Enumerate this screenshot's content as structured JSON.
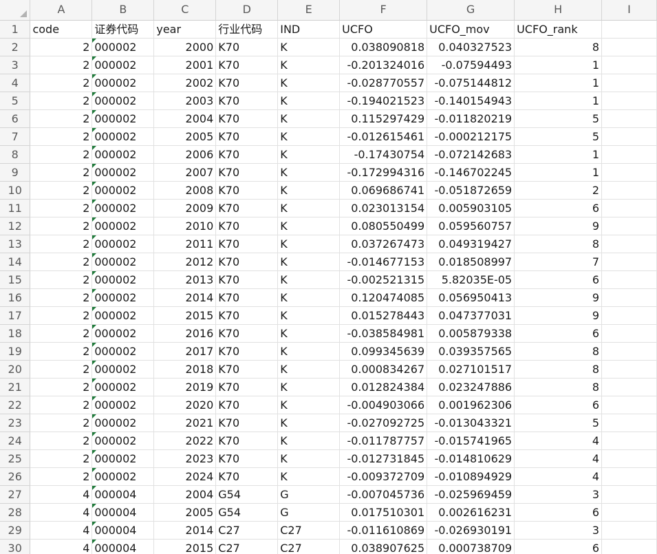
{
  "columns": [
    "A",
    "B",
    "C",
    "D",
    "E",
    "F",
    "G",
    "H",
    "I"
  ],
  "header": [
    "code",
    "证券代码",
    "year",
    "行业代码",
    "IND",
    "UCFO",
    "UCFO_mov",
    "UCFO_rank"
  ],
  "rows": [
    {
      "n": "2",
      "code": "2",
      "sec": "000002",
      "year": "2000",
      "ind_code": "K70",
      "ind": "K",
      "ucfo": "0.038090818",
      "mov": "0.040327523",
      "rank": "8"
    },
    {
      "n": "3",
      "code": "2",
      "sec": "000002",
      "year": "2001",
      "ind_code": "K70",
      "ind": "K",
      "ucfo": "-0.201324016",
      "mov": "-0.07594493",
      "rank": "1"
    },
    {
      "n": "4",
      "code": "2",
      "sec": "000002",
      "year": "2002",
      "ind_code": "K70",
      "ind": "K",
      "ucfo": "-0.028770557",
      "mov": "-0.075144812",
      "rank": "1"
    },
    {
      "n": "5",
      "code": "2",
      "sec": "000002",
      "year": "2003",
      "ind_code": "K70",
      "ind": "K",
      "ucfo": "-0.194021523",
      "mov": "-0.140154943",
      "rank": "1"
    },
    {
      "n": "6",
      "code": "2",
      "sec": "000002",
      "year": "2004",
      "ind_code": "K70",
      "ind": "K",
      "ucfo": "0.115297429",
      "mov": "-0.011820219",
      "rank": "5"
    },
    {
      "n": "7",
      "code": "2",
      "sec": "000002",
      "year": "2005",
      "ind_code": "K70",
      "ind": "K",
      "ucfo": "-0.012615461",
      "mov": "-0.000212175",
      "rank": "5"
    },
    {
      "n": "8",
      "code": "2",
      "sec": "000002",
      "year": "2006",
      "ind_code": "K70",
      "ind": "K",
      "ucfo": "-0.17430754",
      "mov": "-0.072142683",
      "rank": "1"
    },
    {
      "n": "9",
      "code": "2",
      "sec": "000002",
      "year": "2007",
      "ind_code": "K70",
      "ind": "K",
      "ucfo": "-0.172994316",
      "mov": "-0.146702245",
      "rank": "1"
    },
    {
      "n": "10",
      "code": "2",
      "sec": "000002",
      "year": "2008",
      "ind_code": "K70",
      "ind": "K",
      "ucfo": "0.069686741",
      "mov": "-0.051872659",
      "rank": "2"
    },
    {
      "n": "11",
      "code": "2",
      "sec": "000002",
      "year": "2009",
      "ind_code": "K70",
      "ind": "K",
      "ucfo": "0.023013154",
      "mov": "0.005903105",
      "rank": "6"
    },
    {
      "n": "12",
      "code": "2",
      "sec": "000002",
      "year": "2010",
      "ind_code": "K70",
      "ind": "K",
      "ucfo": "0.080550499",
      "mov": "0.059560757",
      "rank": "9"
    },
    {
      "n": "13",
      "code": "2",
      "sec": "000002",
      "year": "2011",
      "ind_code": "K70",
      "ind": "K",
      "ucfo": "0.037267473",
      "mov": "0.049319427",
      "rank": "8"
    },
    {
      "n": "14",
      "code": "2",
      "sec": "000002",
      "year": "2012",
      "ind_code": "K70",
      "ind": "K",
      "ucfo": "-0.014677153",
      "mov": "0.018508997",
      "rank": "7"
    },
    {
      "n": "15",
      "code": "2",
      "sec": "000002",
      "year": "2013",
      "ind_code": "K70",
      "ind": "K",
      "ucfo": "-0.002521315",
      "mov": "5.82035E-05",
      "rank": "6"
    },
    {
      "n": "16",
      "code": "2",
      "sec": "000002",
      "year": "2014",
      "ind_code": "K70",
      "ind": "K",
      "ucfo": "0.120474085",
      "mov": "0.056950413",
      "rank": "9"
    },
    {
      "n": "17",
      "code": "2",
      "sec": "000002",
      "year": "2015",
      "ind_code": "K70",
      "ind": "K",
      "ucfo": "0.015278443",
      "mov": "0.047377031",
      "rank": "9"
    },
    {
      "n": "18",
      "code": "2",
      "sec": "000002",
      "year": "2016",
      "ind_code": "K70",
      "ind": "K",
      "ucfo": "-0.038584981",
      "mov": "0.005879338",
      "rank": "6"
    },
    {
      "n": "19",
      "code": "2",
      "sec": "000002",
      "year": "2017",
      "ind_code": "K70",
      "ind": "K",
      "ucfo": "0.099345639",
      "mov": "0.039357565",
      "rank": "8"
    },
    {
      "n": "20",
      "code": "2",
      "sec": "000002",
      "year": "2018",
      "ind_code": "K70",
      "ind": "K",
      "ucfo": "0.000834267",
      "mov": "0.027101517",
      "rank": "8"
    },
    {
      "n": "21",
      "code": "2",
      "sec": "000002",
      "year": "2019",
      "ind_code": "K70",
      "ind": "K",
      "ucfo": "0.012824384",
      "mov": "0.023247886",
      "rank": "8"
    },
    {
      "n": "22",
      "code": "2",
      "sec": "000002",
      "year": "2020",
      "ind_code": "K70",
      "ind": "K",
      "ucfo": "-0.004903066",
      "mov": "0.001962306",
      "rank": "6"
    },
    {
      "n": "23",
      "code": "2",
      "sec": "000002",
      "year": "2021",
      "ind_code": "K70",
      "ind": "K",
      "ucfo": "-0.027092725",
      "mov": "-0.013043321",
      "rank": "5"
    },
    {
      "n": "24",
      "code": "2",
      "sec": "000002",
      "year": "2022",
      "ind_code": "K70",
      "ind": "K",
      "ucfo": "-0.011787757",
      "mov": "-0.015741965",
      "rank": "4"
    },
    {
      "n": "25",
      "code": "2",
      "sec": "000002",
      "year": "2023",
      "ind_code": "K70",
      "ind": "K",
      "ucfo": "-0.012731845",
      "mov": "-0.014810629",
      "rank": "4"
    },
    {
      "n": "26",
      "code": "2",
      "sec": "000002",
      "year": "2024",
      "ind_code": "K70",
      "ind": "K",
      "ucfo": "-0.009372709",
      "mov": "-0.010894929",
      "rank": "4"
    },
    {
      "n": "27",
      "code": "4",
      "sec": "000004",
      "year": "2004",
      "ind_code": "G54",
      "ind": "G",
      "ucfo": "-0.007045736",
      "mov": "-0.025969459",
      "rank": "3"
    },
    {
      "n": "28",
      "code": "4",
      "sec": "000004",
      "year": "2005",
      "ind_code": "G54",
      "ind": "G",
      "ucfo": "0.017510301",
      "mov": "0.002616231",
      "rank": "6"
    },
    {
      "n": "29",
      "code": "4",
      "sec": "000004",
      "year": "2014",
      "ind_code": "C27",
      "ind": "C27",
      "ucfo": "-0.011610869",
      "mov": "-0.026930191",
      "rank": "3"
    },
    {
      "n": "30",
      "code": "4",
      "sec": "000004",
      "year": "2015",
      "ind_code": "C27",
      "ind": "C27",
      "ucfo": "0.038907625",
      "mov": "0.000738709",
      "rank": "6"
    }
  ]
}
